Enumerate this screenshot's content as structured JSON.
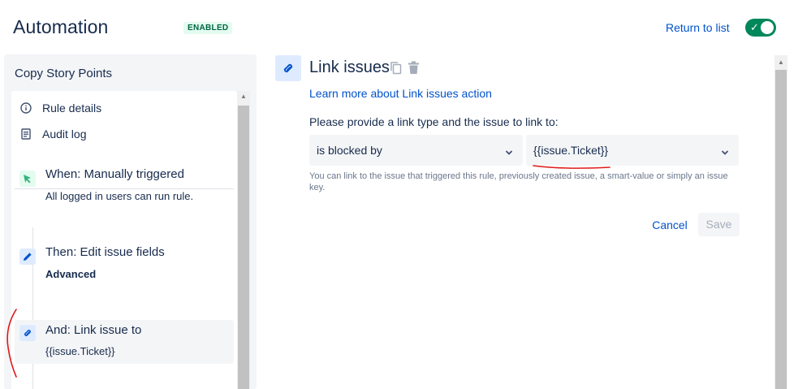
{
  "header": {
    "title": "Automation",
    "status": "ENABLED",
    "return_label": "Return to list",
    "toggle_on": true,
    "toggle_check": "✓"
  },
  "rule": {
    "name": "Copy Story Points",
    "meta": [
      {
        "label": "Rule details",
        "icon": "info-icon"
      },
      {
        "label": "Audit log",
        "icon": "audit-log-icon"
      }
    ],
    "components": [
      {
        "title": "When: Manually triggered",
        "subtitle": "All logged in users can run rule.",
        "icon": "trigger-cursor-icon",
        "color": "#36b37e"
      },
      {
        "title": "Then: Edit issue fields",
        "subtitle": "Advanced",
        "icon": "pencil-icon",
        "color": "#0052cc"
      },
      {
        "title": "And: Link issue to",
        "subtitle": "{{issue.Ticket}}",
        "icon": "link-icon",
        "color": "#0052cc",
        "selected": true
      }
    ]
  },
  "detail": {
    "title": "Link issues",
    "learn_more": "Learn more about Link issues action",
    "instruction": "Please provide a link type and the issue to link to:",
    "link_type": "is blocked by",
    "issue_value": "{{issue.Ticket}}",
    "helper": "You can link to the issue that triggered this rule, previously created issue, a smart-value or simply an issue key.",
    "cancel_label": "Cancel",
    "save_label": "Save"
  },
  "colors": {
    "accent": "#0052cc",
    "enabled_green": "#00875a",
    "annotation_red": "#e01818"
  }
}
